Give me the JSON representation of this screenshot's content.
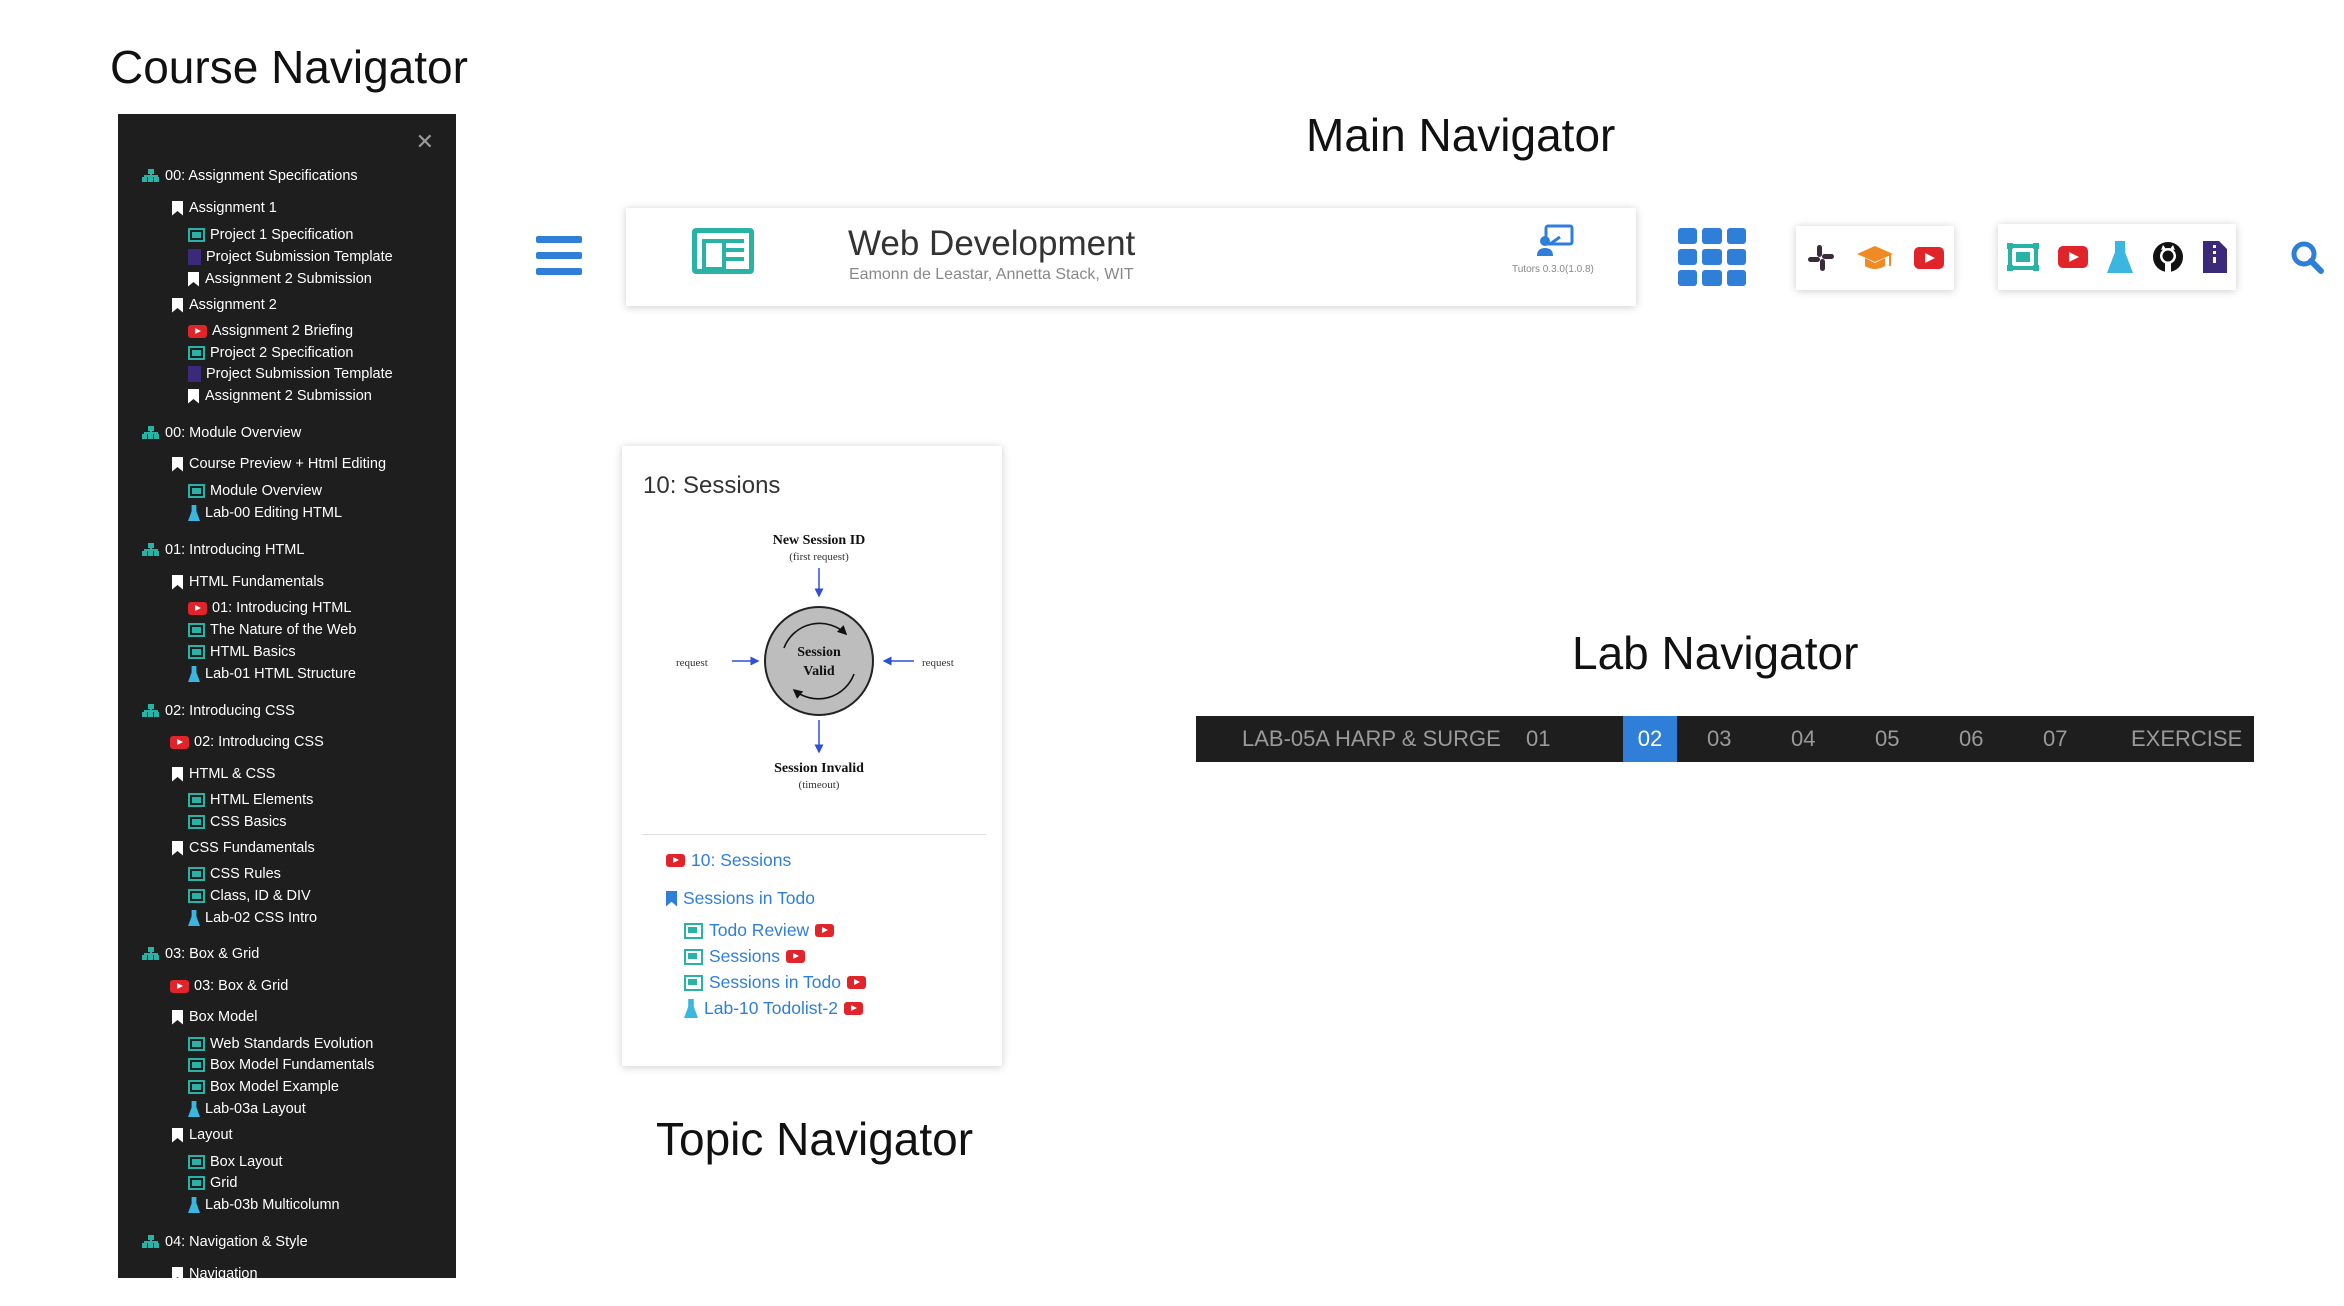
{
  "captions": {
    "course": "Course Navigator",
    "main": "Main Navigator",
    "topic": "Topic Navigator",
    "lab": "Lab Navigator"
  },
  "course_nav": {
    "items": [
      {
        "level": 0,
        "icon": "sitemap-icon",
        "label": "00: Assignment Specifications"
      },
      {
        "level": 1,
        "icon": "bookmark-icon",
        "label": "Assignment 1"
      },
      {
        "level": 2,
        "icon": "talk-icon",
        "label": "Project 1 Specification"
      },
      {
        "level": 2,
        "icon": "file-icon",
        "label": "Project Submission Template"
      },
      {
        "level": 2,
        "icon": "bookmark-icon",
        "label": "Assignment 2 Submission"
      },
      {
        "level": 1,
        "icon": "bookmark-icon",
        "label": "Assignment 2"
      },
      {
        "level": 2,
        "icon": "video-icon",
        "label": "Assignment 2 Briefing"
      },
      {
        "level": 2,
        "icon": "talk-icon",
        "label": "Project 2 Specification"
      },
      {
        "level": 2,
        "icon": "file-icon",
        "label": "Project Submission Template"
      },
      {
        "level": 2,
        "icon": "bookmark-icon",
        "label": "Assignment 2 Submission"
      },
      {
        "level": 0,
        "icon": "sitemap-icon",
        "label": "00: Module Overview"
      },
      {
        "level": 1,
        "icon": "bookmark-icon",
        "label": "Course Preview + Html Editing"
      },
      {
        "level": 2,
        "icon": "talk-icon",
        "label": "Module Overview"
      },
      {
        "level": 2,
        "icon": "lab-icon",
        "label": "Lab-00 Editing HTML"
      },
      {
        "level": 0,
        "icon": "sitemap-icon",
        "label": "01: Introducing HTML"
      },
      {
        "level": 1,
        "icon": "bookmark-icon",
        "label": "HTML Fundamentals"
      },
      {
        "level": 2,
        "icon": "video-icon",
        "label": "01: Introducing HTML"
      },
      {
        "level": 2,
        "icon": "talk-icon",
        "label": "The Nature of the Web"
      },
      {
        "level": 2,
        "icon": "talk-icon",
        "label": "HTML Basics"
      },
      {
        "level": 2,
        "icon": "lab-icon",
        "label": "Lab-01 HTML Structure"
      },
      {
        "level": 0,
        "icon": "sitemap-icon",
        "label": "02: Introducing CSS"
      },
      {
        "level": 1,
        "icon": "video-icon",
        "label": "02: Introducing CSS"
      },
      {
        "level": 1,
        "icon": "bookmark-icon",
        "label": "HTML & CSS"
      },
      {
        "level": 2,
        "icon": "talk-icon",
        "label": "HTML Elements"
      },
      {
        "level": 2,
        "icon": "talk-icon",
        "label": "CSS Basics"
      },
      {
        "level": 1,
        "icon": "bookmark-icon",
        "label": "CSS Fundamentals"
      },
      {
        "level": 2,
        "icon": "talk-icon",
        "label": "CSS Rules"
      },
      {
        "level": 2,
        "icon": "talk-icon",
        "label": "Class, ID & DIV"
      },
      {
        "level": 2,
        "icon": "lab-icon",
        "label": "Lab-02 CSS Intro"
      },
      {
        "level": 0,
        "icon": "sitemap-icon",
        "label": "03: Box & Grid"
      },
      {
        "level": 1,
        "icon": "video-icon",
        "label": "03: Box & Grid"
      },
      {
        "level": 1,
        "icon": "bookmark-icon",
        "label": "Box Model"
      },
      {
        "level": 2,
        "icon": "talk-icon",
        "label": "Web Standards Evolution"
      },
      {
        "level": 2,
        "icon": "talk-icon",
        "label": "Box Model Fundamentals"
      },
      {
        "level": 2,
        "icon": "talk-icon",
        "label": "Box Model Example"
      },
      {
        "level": 2,
        "icon": "lab-icon",
        "label": "Lab-03a Layout"
      },
      {
        "level": 1,
        "icon": "bookmark-icon",
        "label": "Layout"
      },
      {
        "level": 2,
        "icon": "talk-icon",
        "label": "Box Layout"
      },
      {
        "level": 2,
        "icon": "talk-icon",
        "label": "Grid"
      },
      {
        "level": 2,
        "icon": "lab-icon",
        "label": "Lab-03b Multicolumn"
      },
      {
        "level": 0,
        "icon": "sitemap-icon",
        "label": "04: Navigation & Style"
      },
      {
        "level": 1,
        "icon": "bookmark-icon",
        "label": "Navigation"
      }
    ]
  },
  "main_nav": {
    "title": "Web Development",
    "subtitle": "Eamonn de Leastar, Annetta Stack, WIT",
    "version": "Tutors 0.3.0(1.0.8)",
    "companions": [
      "slack-icon",
      "graduation-cap-icon",
      "youtube-icon"
    ],
    "walls": [
      "talk-icon",
      "youtube-icon",
      "lab-icon",
      "github-icon",
      "archive-icon"
    ]
  },
  "topic_nav": {
    "title": "10: Sessions",
    "diagram": {
      "top_label": "New Session ID",
      "top_sub": "(first request)",
      "center_line1": "Session",
      "center_line2": "Valid",
      "left_label": "request",
      "right_label": "request",
      "bottom_label": "Session Invalid",
      "bottom_sub": "(timeout)"
    },
    "video_link": "10: Sessions",
    "unit_label": "Sessions in Todo",
    "items": [
      {
        "icon": "talk-icon",
        "label": "Todo Review",
        "video": true
      },
      {
        "icon": "talk-icon",
        "label": "Sessions",
        "video": true
      },
      {
        "icon": "talk-icon",
        "label": "Sessions in Todo",
        "video": true
      },
      {
        "icon": "lab-icon",
        "label": "Lab-10 Todolist-2",
        "video": true
      }
    ]
  },
  "lab_nav": {
    "title": "LAB-05A HARP & SURGE",
    "steps": [
      "01",
      "02",
      "03",
      "04",
      "05",
      "06",
      "07",
      "EXERCISE"
    ],
    "active_step": "02"
  },
  "colors": {
    "accent_blue": "#2f7fd9",
    "teal": "#29b3a6",
    "youtube_red": "#e0242a",
    "dark_panel": "#1e1e1e"
  }
}
